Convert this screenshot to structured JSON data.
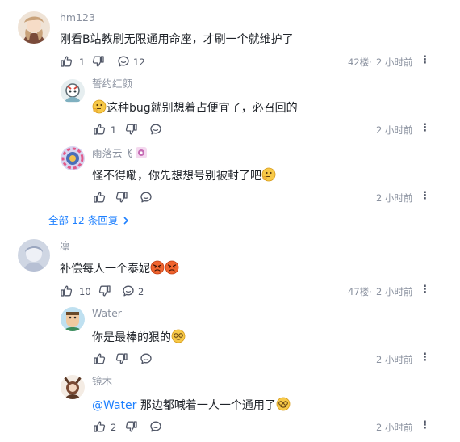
{
  "comments": [
    {
      "user": "hm123",
      "text": "刚看B站教刷无限通用命座，才刷一个就维护了",
      "likes": "1",
      "reply_count": "12",
      "floor": "42楼",
      "time": "2 小时前",
      "replies": [
        {
          "user": "誓约红颜",
          "text": "这种bug就别想着占便宜了，必召回的",
          "likes": "1",
          "time": "2 小时前"
        },
        {
          "user": "雨落云飞",
          "text": "怪不得嘞，你先想想号别被封了吧",
          "likes": "",
          "time": "2 小时前"
        }
      ],
      "view_all": "全部 12 条回复"
    },
    {
      "user": "凛",
      "text": "补偿每人一个泰妮",
      "likes": "10",
      "reply_count": "2",
      "floor": "47楼",
      "time": "2 小时前",
      "replies": [
        {
          "user": "Water",
          "text": "你是最棒的狠的",
          "likes": "",
          "time": "2 小时前"
        },
        {
          "user": "镜木",
          "mention": "@Water",
          "text": " 那边都喊着一人一个通用了",
          "likes": "2",
          "time": "2 小时前"
        }
      ]
    }
  ],
  "separator": "·",
  "icons": [
    "like-icon",
    "dislike-icon",
    "comment-icon",
    "more-icon",
    "chevron-right-icon"
  ],
  "colors": {
    "link": "#1e80ff",
    "muted": "#8a919f",
    "text": "#1f2329"
  }
}
